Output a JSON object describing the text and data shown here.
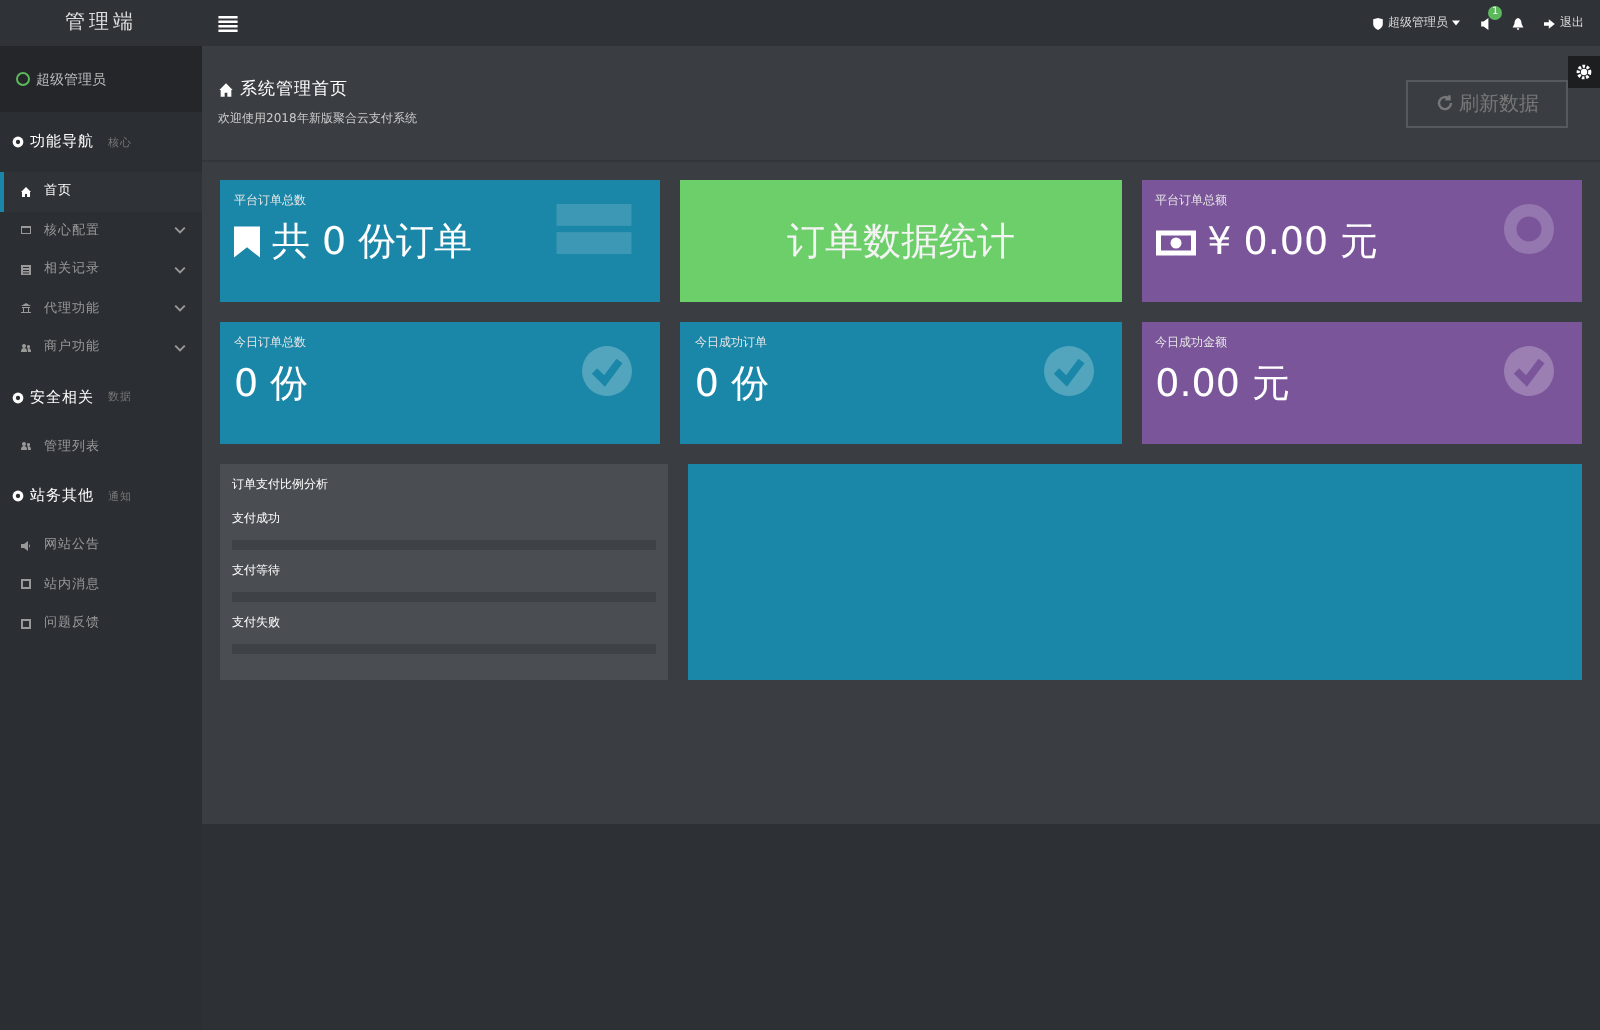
{
  "brand": "管理端",
  "user": {
    "name": "超级管理员",
    "online": true
  },
  "sidebar": {
    "sections": [
      {
        "title": "功能导航",
        "tag": "核心",
        "items": [
          {
            "label": "首页",
            "selected": true,
            "expandable": false
          },
          {
            "label": "核心配置",
            "selected": false,
            "expandable": true
          },
          {
            "label": "相关记录",
            "selected": false,
            "expandable": true
          },
          {
            "label": "代理功能",
            "selected": false,
            "expandable": true
          },
          {
            "label": "商户功能",
            "selected": false,
            "expandable": true
          }
        ]
      },
      {
        "title": "安全相关",
        "tag": "数据",
        "items": [
          {
            "label": "管理列表",
            "selected": false,
            "expandable": false
          }
        ]
      },
      {
        "title": "站务其他",
        "tag": "通知",
        "items": [
          {
            "label": "网站公告",
            "selected": false,
            "expandable": false
          },
          {
            "label": "站内消息",
            "selected": false,
            "expandable": false
          },
          {
            "label": "问题反馈",
            "selected": false,
            "expandable": false
          }
        ]
      }
    ]
  },
  "topbar": {
    "account": "超级管理员",
    "message_count": "1",
    "logout": "退出"
  },
  "page": {
    "title": "系统管理首页",
    "subtitle": "欢迎使用2018年新版聚合云支付系统",
    "refresh_button": "刷新数据"
  },
  "cards": [
    {
      "kind": "stat",
      "color": "#1a87a8",
      "label": "平台订单总数",
      "value": "共 0 份订单"
    },
    {
      "kind": "banner",
      "color": "#6ccf6a",
      "value": "订单数据统计"
    },
    {
      "kind": "stat",
      "color": "#7a559a",
      "label": "平台订单总额",
      "value": "¥ 0.00 元"
    },
    {
      "kind": "stat",
      "color": "#1a87a8",
      "label": "今日订单总数",
      "value": "0 份"
    },
    {
      "kind": "stat",
      "color": "#1a87a8",
      "label": "今日成功订单",
      "value": "0 份"
    },
    {
      "kind": "stat",
      "color": "#7a559a",
      "label": "今日成功金额",
      "value": "0.00 元"
    }
  ],
  "analysis": {
    "title": "订单支付比例分析",
    "rows": [
      {
        "label": "支付成功",
        "level": 0
      },
      {
        "label": "支付等待",
        "level": 0
      },
      {
        "label": "支付失败",
        "level": 0
      }
    ]
  }
}
